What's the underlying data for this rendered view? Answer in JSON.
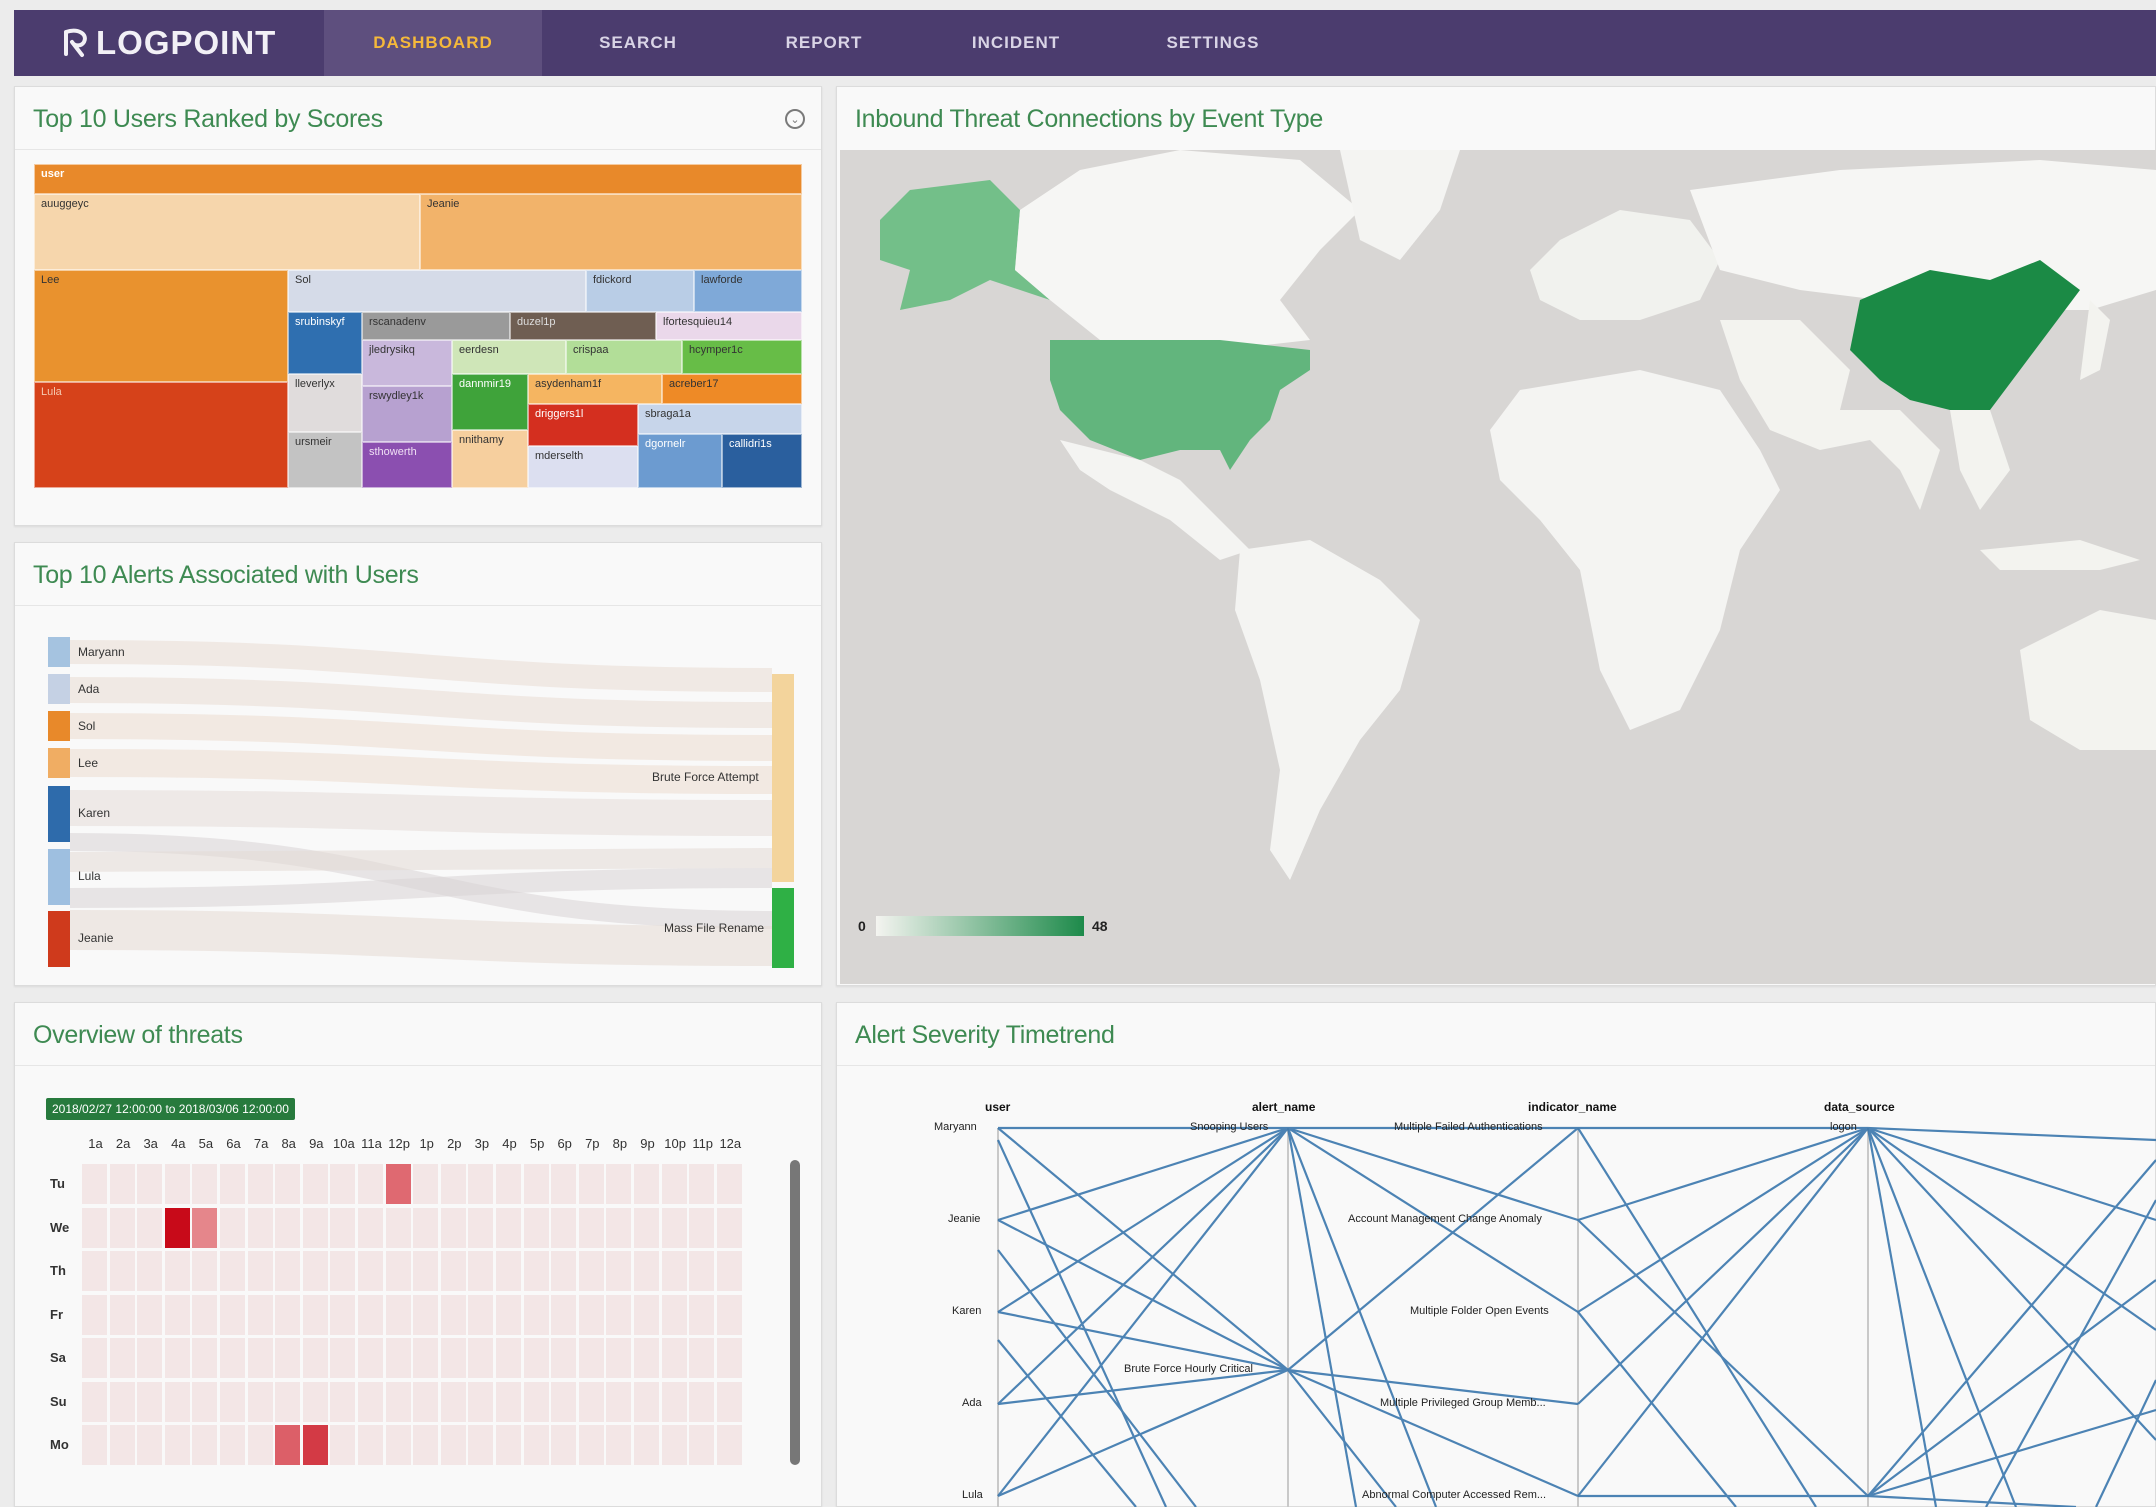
{
  "nav": {
    "logo": "LOGPOINT",
    "tabs": [
      {
        "label": "DASHBOARD",
        "active": true
      },
      {
        "label": "SEARCH",
        "active": false
      },
      {
        "label": "REPORT",
        "active": false
      },
      {
        "label": "INCIDENT",
        "active": false
      },
      {
        "label": "SETTINGS",
        "active": false
      }
    ]
  },
  "panels": {
    "top_users": {
      "title": "Top 10 Users Ranked by Scores",
      "root_label": "user",
      "tiles": [
        "auuggeyc",
        "Jeanie",
        "Lee",
        "Sol",
        "fdickord",
        "lawforde",
        "srubinskyf",
        "rscanadenv",
        "duzel1p",
        "lfortesquieu14",
        "jledrysikq",
        "eerdesn",
        "crispaa",
        "hcymper1c",
        "Lula",
        "lleverlyx",
        "rswydley1k",
        "dannmir19",
        "asydenham1f",
        "acreber17",
        "driggers1l",
        "sbraga1a",
        "ursmeir",
        "sthowerth",
        "nnithamy",
        "mderselth",
        "dgornelr",
        "callidri1s"
      ]
    },
    "top_alerts": {
      "title": "Top 10 Alerts Associated with Users",
      "users": [
        "Maryann",
        "Ada",
        "Sol",
        "Lee",
        "Karen",
        "Lula",
        "Jeanie"
      ],
      "alerts": [
        "Brute Force Attempt",
        "Mass File Rename"
      ]
    },
    "inbound_map": {
      "title": "Inbound Threat Connections by Event Type",
      "legend_min": "0",
      "legend_max": "48",
      "colors": {
        "low": "#f4f4f0",
        "high": "#1d8a4a"
      }
    },
    "overview": {
      "title": "Overview of threats",
      "date_range": "2018/02/27 12:00:00 to 2018/03/06 12:00:00",
      "hours": [
        "1a",
        "2a",
        "3a",
        "4a",
        "5a",
        "6a",
        "7a",
        "8a",
        "9a",
        "10a",
        "11a",
        "12p",
        "1p",
        "2p",
        "3p",
        "4p",
        "5p",
        "6p",
        "7p",
        "8p",
        "9p",
        "10p",
        "11p",
        "12a"
      ],
      "days": [
        "Tu",
        "We",
        "Th",
        "Fr",
        "Sa",
        "Su",
        "Mo"
      ],
      "hot_cells": [
        {
          "day": "Tu",
          "hour": "12p",
          "level": 0.5
        },
        {
          "day": "We",
          "hour": "4a",
          "level": 1.0
        },
        {
          "day": "We",
          "hour": "5a",
          "level": 0.35
        },
        {
          "day": "Mo",
          "hour": "8a",
          "level": 0.55
        },
        {
          "day": "Mo",
          "hour": "9a",
          "level": 0.75
        }
      ]
    },
    "severity": {
      "title": "Alert Severity Timetrend",
      "axes": [
        "user",
        "alert_name",
        "indicator_name",
        "data_source"
      ],
      "users": [
        "Maryann",
        "Jeanie",
        "Karen",
        "Ada",
        "Lula"
      ],
      "alert_names": [
        "Snooping Users",
        "Brute Force Hourly Critical"
      ],
      "indicators": [
        "Multiple Failed Authentications",
        "Account Management Change Anomaly",
        "Multiple Folder Open Events",
        "Multiple Privileged Group Memb...",
        "Abnormal Computer Accessed Rem..."
      ],
      "data_sources": [
        "logon"
      ]
    }
  }
}
